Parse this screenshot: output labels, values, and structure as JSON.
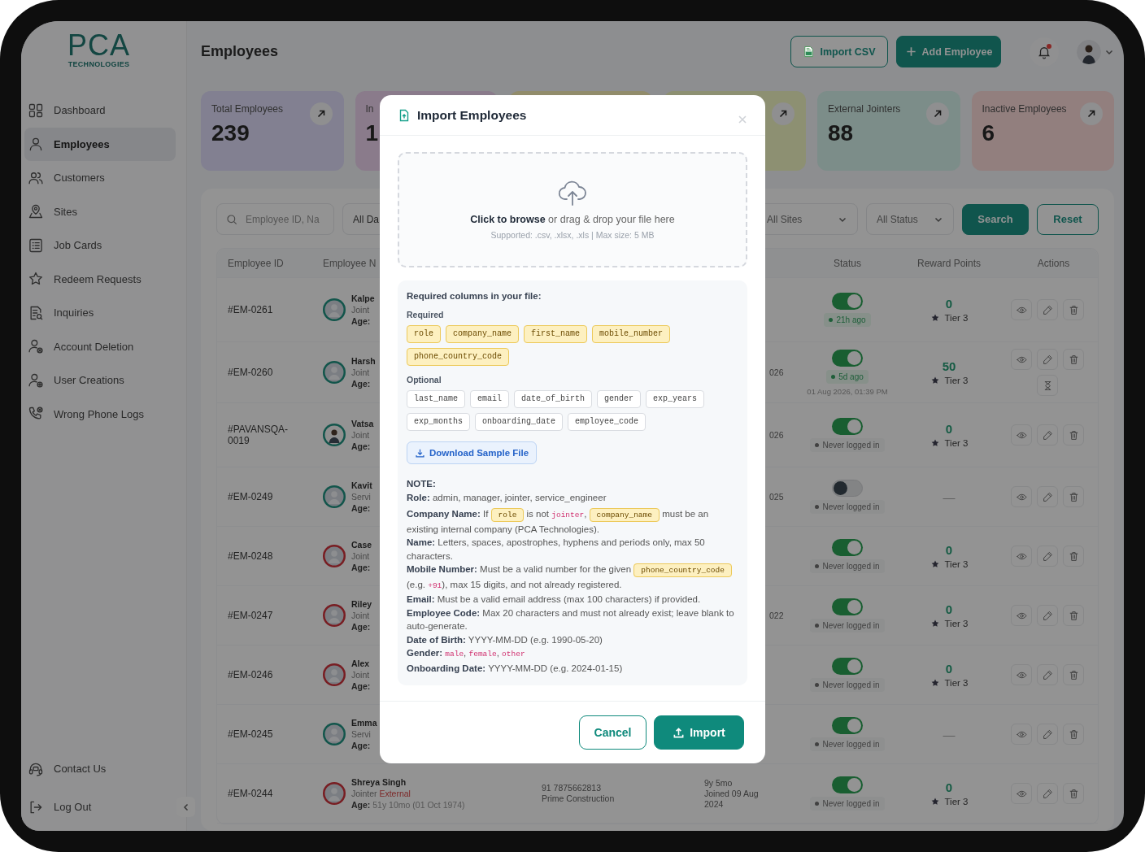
{
  "sidebar": {
    "logo": {
      "title": "PCA",
      "subtitle": "TECHNOLOGIES"
    },
    "items": [
      {
        "label": "Dashboard",
        "kind": "grid",
        "selected": false
      },
      {
        "label": "Employees",
        "kind": "person",
        "selected": true
      },
      {
        "label": "Customers",
        "kind": "people",
        "selected": false
      },
      {
        "label": "Sites",
        "kind": "pin",
        "selected": false
      },
      {
        "label": "Job Cards",
        "kind": "list",
        "selected": false
      },
      {
        "label": "Redeem Requests",
        "kind": "star",
        "selected": false
      },
      {
        "label": "Inquiries",
        "kind": "docsearch",
        "selected": false
      },
      {
        "label": "Account Deletion",
        "kind": "personx",
        "selected": false
      },
      {
        "label": "User Creations",
        "kind": "personplus",
        "selected": false
      },
      {
        "label": "Wrong Phone Logs",
        "kind": "phonex",
        "selected": false
      }
    ],
    "footer_items": [
      {
        "label": "Contact Us",
        "kind": "headset"
      },
      {
        "label": "Log Out",
        "kind": "logout"
      }
    ]
  },
  "header": {
    "title": "Employees",
    "buttons": [
      {
        "label": "Import CSV",
        "kind": "outline"
      },
      {
        "label": "Add Employee",
        "kind": "primary"
      }
    ],
    "notifications": {
      "unread": true
    }
  },
  "stats": [
    {
      "label": "Total Employees",
      "value": "239",
      "color": "#828091",
      "link_icon": true
    },
    {
      "label": "In",
      "value": "1",
      "color": "#8a7b8b",
      "link_icon": false
    },
    {
      "color": "#918c6b",
      "link_icon": false
    },
    {
      "color": "#8d9072",
      "link_icon": true
    },
    {
      "label": "External Jointers",
      "value": "88",
      "color": "#7c8d89",
      "link_icon": true
    },
    {
      "label": "Inactive Employees",
      "value": "6",
      "color": "#927f7e",
      "link_icon": true
    }
  ],
  "filters": {
    "search": {
      "placeholder": "Employee ID, Na"
    },
    "selects": [
      {
        "value": "All Da"
      },
      {
        "value": "All Sites",
        "caret": true
      },
      {
        "value": "All Status",
        "caret": true
      }
    ],
    "buttons": [
      {
        "label": "Search",
        "kind": "primary"
      },
      {
        "label": "Reset",
        "kind": "outline"
      }
    ]
  },
  "table": {
    "columns": [
      "Employee ID",
      "Employee N",
      "Status",
      "Reward Points",
      "Actions"
    ],
    "rows": [
      {
        "id": "#EM-0261",
        "avatar": {
          "kind": "placeholder",
          "color": "#12554b"
        },
        "name": "Kalpe",
        "role": "Joint",
        "age_label": "Age:",
        "status": {
          "active": true,
          "login": {
            "text": "21h ago",
            "kind": "recent"
          }
        },
        "points": "0",
        "tier": "Tier 3",
        "actions": [
          {
            "kind": "view"
          },
          {
            "kind": "edit"
          },
          {
            "kind": "delete"
          }
        ]
      },
      {
        "id": "#EM-0260",
        "avatar": {
          "kind": "placeholder",
          "color": "#12554b"
        },
        "name": "Harsh",
        "role": "Joint",
        "age_label": "Age:",
        "experience": [
          "026"
        ],
        "status": {
          "active": true,
          "login": {
            "text": "5d ago",
            "kind": "recent"
          },
          "last_seen": "01 Aug 2026, 01:39 PM"
        },
        "points": "50",
        "tier": "Tier 3",
        "actions": [
          {
            "kind": "view"
          },
          {
            "kind": "edit"
          },
          {
            "kind": "delete"
          },
          {
            "kind": "hourglass"
          }
        ]
      },
      {
        "id": "#PAVANSQA-0019",
        "avatar": {
          "kind": "photo",
          "color": "#12554b"
        },
        "name": "Vatsa",
        "role": "Joint",
        "age_label": "Age:",
        "experience": [
          "026"
        ],
        "status": {
          "active": true,
          "login": {
            "text": "Never logged in",
            "kind": "never"
          }
        },
        "points": "0",
        "tier": "Tier 3",
        "actions": [
          {
            "kind": "view"
          },
          {
            "kind": "edit"
          },
          {
            "kind": "delete"
          }
        ]
      },
      {
        "id": "#EM-0249",
        "avatar": {
          "kind": "placeholder",
          "color": "#12554b"
        },
        "name": "Kavit",
        "role": "Servi",
        "age_label": "Age:",
        "experience": [
          "025"
        ],
        "status": {
          "active": false,
          "login": {
            "text": "Never logged in",
            "kind": "never"
          }
        },
        "points": "—",
        "actions": [
          {
            "kind": "view"
          },
          {
            "kind": "edit"
          },
          {
            "kind": "delete"
          }
        ]
      },
      {
        "id": "#EM-0248",
        "avatar": {
          "kind": "placeholder",
          "color": "#781d22"
        },
        "name": "Case",
        "role": "Joint",
        "age_label": "Age:",
        "status": {
          "active": true,
          "login": {
            "text": "Never logged in",
            "kind": "never"
          }
        },
        "points": "0",
        "tier": "Tier 3",
        "actions": [
          {
            "kind": "view"
          },
          {
            "kind": "edit"
          },
          {
            "kind": "delete"
          }
        ]
      },
      {
        "id": "#EM-0247",
        "avatar": {
          "kind": "placeholder",
          "color": "#781d22"
        },
        "name": "Riley",
        "role": "Joint",
        "age_label": "Age:",
        "experience": [
          "022"
        ],
        "status": {
          "active": true,
          "login": {
            "text": "Never logged in",
            "kind": "never"
          }
        },
        "points": "0",
        "tier": "Tier 3",
        "actions": [
          {
            "kind": "view"
          },
          {
            "kind": "edit"
          },
          {
            "kind": "delete"
          }
        ]
      },
      {
        "id": "#EM-0246",
        "avatar": {
          "kind": "placeholder",
          "color": "#781d22"
        },
        "name": "Alex",
        "role": "Joint",
        "age_label": "Age:",
        "status": {
          "active": true,
          "login": {
            "text": "Never logged in",
            "kind": "never"
          }
        },
        "points": "0",
        "tier": "Tier 3",
        "actions": [
          {
            "kind": "view"
          },
          {
            "kind": "edit"
          },
          {
            "kind": "delete"
          }
        ]
      },
      {
        "id": "#EM-0245",
        "avatar": {
          "kind": "placeholder",
          "color": "#12554b"
        },
        "name": "Emma",
        "role": "Servi",
        "age_label": "Age:",
        "status": {
          "active": true,
          "login": {
            "text": "Never logged in",
            "kind": "never"
          }
        },
        "points": "—",
        "actions": [
          {
            "kind": "view"
          },
          {
            "kind": "edit"
          },
          {
            "kind": "delete"
          }
        ]
      },
      {
        "id": "#EM-0244",
        "avatar": {
          "kind": "placeholder",
          "color": "#781d22"
        },
        "name": "Shreya Singh",
        "role": "Jointer",
        "tag": "External",
        "age_label": "Age:",
        "age": "51y 10mo (01 Oct 1974)",
        "contact": [
          "91 7875662813",
          "Prime Construction"
        ],
        "experience": [
          "9y 5mo",
          "Joined 09 Aug",
          "2024"
        ],
        "status": {
          "active": true,
          "login": {
            "text": "Never logged in",
            "kind": "never"
          }
        },
        "points": "0",
        "tier": "Tier 3",
        "actions": [
          {
            "kind": "view"
          },
          {
            "kind": "edit"
          },
          {
            "kind": "delete"
          }
        ]
      }
    ]
  },
  "modal": {
    "title": "Import Employees",
    "dropzone": {
      "prompt": "**Click to browse** or drag & drop your file here",
      "hint": "Supported: .csv, .xlsx, .xls | Max size: 5 MB"
    },
    "columns_info": {
      "title": "Required columns in your file:",
      "groups": [
        {
          "label": "Required",
          "kind": "required",
          "chips": [
            "role",
            "company_name",
            "first_name",
            "mobile_number",
            "phone_country_code"
          ]
        },
        {
          "label": "Optional",
          "kind": "optional",
          "chips": [
            "last_name",
            "email",
            "date_of_birth",
            "gender",
            "exp_years",
            "exp_months",
            "onboarding_date",
            "employee_code"
          ]
        }
      ]
    },
    "download_button": "Download Sample File",
    "note": {
      "title": "NOTE:",
      "lines": [
        {
          "label": "Role:",
          "parts": [
            {
              "kind": "text",
              "text": "admin, manager, jointer, service_engineer"
            }
          ]
        },
        {
          "label": "Company Name:",
          "parts": [
            {
              "kind": "text",
              "text": "If "
            },
            {
              "kind": "chip",
              "text": "role"
            },
            {
              "kind": "text",
              "text": " is not "
            },
            {
              "kind": "code",
              "text": "jointer"
            },
            {
              "kind": "text",
              "text": ", "
            },
            {
              "kind": "chip",
              "text": "company_name"
            },
            {
              "kind": "text",
              "text": " must be an existing internal company (PCA Technologies)."
            }
          ]
        },
        {
          "label": "Name:",
          "parts": [
            {
              "kind": "text",
              "text": "Letters, spaces, apostrophes, hyphens and periods only, max 50 characters."
            }
          ]
        },
        {
          "label": "Mobile Number:",
          "parts": [
            {
              "kind": "text",
              "text": "Must be a valid number for the given "
            },
            {
              "kind": "chip",
              "text": "phone_country_code"
            },
            {
              "kind": "text",
              "text": " (e.g. "
            },
            {
              "kind": "code",
              "text": "+91"
            },
            {
              "kind": "text",
              "text": "), max 15 digits, and not already registered."
            }
          ]
        },
        {
          "label": "Email:",
          "parts": [
            {
              "kind": "text",
              "text": "Must be a valid email address (max 100 characters) if provided."
            }
          ]
        },
        {
          "label": "Employee Code:",
          "parts": [
            {
              "kind": "text",
              "text": "Max 20 characters and must not already exist; leave blank to auto-generate."
            }
          ]
        },
        {
          "label": "Date of Birth:",
          "parts": [
            {
              "kind": "text",
              "text": "YYYY-MM-DD (e.g. 1990-05-20)"
            }
          ]
        },
        {
          "label": "Gender:",
          "parts": [
            {
              "kind": "code",
              "text": "male"
            },
            {
              "kind": "text",
              "text": ", "
            },
            {
              "kind": "code",
              "text": "female"
            },
            {
              "kind": "text",
              "text": ", "
            },
            {
              "kind": "code",
              "text": "other"
            }
          ]
        },
        {
          "label": "Onboarding Date:",
          "parts": [
            {
              "kind": "text",
              "text": "YYYY-MM-DD (e.g. 2024-01-15)"
            }
          ]
        }
      ]
    },
    "buttons": [
      {
        "label": "Cancel",
        "kind": "outline"
      },
      {
        "label": "Import",
        "kind": "primary"
      }
    ]
  }
}
